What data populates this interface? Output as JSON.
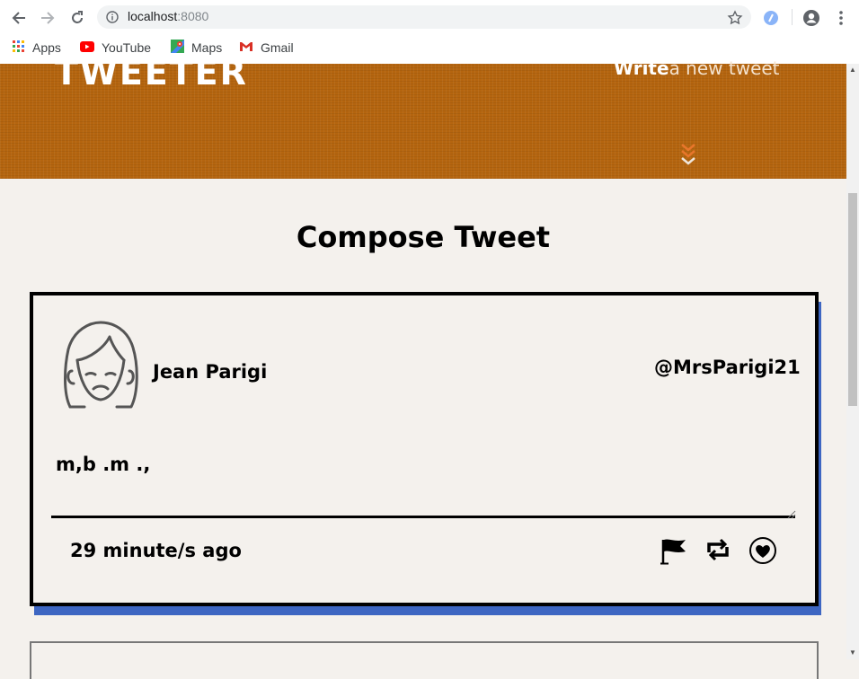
{
  "browser": {
    "url_host": "localhost",
    "url_port": ":8080",
    "bookmarks": [
      {
        "label": "Apps",
        "icon": "apps-grid-icon"
      },
      {
        "label": "YouTube",
        "icon": "youtube-icon"
      },
      {
        "label": "Maps",
        "icon": "maps-icon"
      },
      {
        "label": "Gmail",
        "icon": "gmail-icon"
      }
    ]
  },
  "header": {
    "logo": "TWEETER",
    "write_bold": "Write",
    "write_light": "a new tweet",
    "accent": "#b5650f"
  },
  "main": {
    "title": "Compose Tweet"
  },
  "tweet": {
    "name": "Jean Parigi",
    "handle": "@MrsParigi21",
    "content": "m,b .m .,",
    "time": "29 minute/s ago",
    "actions": [
      "flag-icon",
      "retweet-icon",
      "heart-icon"
    ],
    "shadow_color": "#3d66c2"
  }
}
